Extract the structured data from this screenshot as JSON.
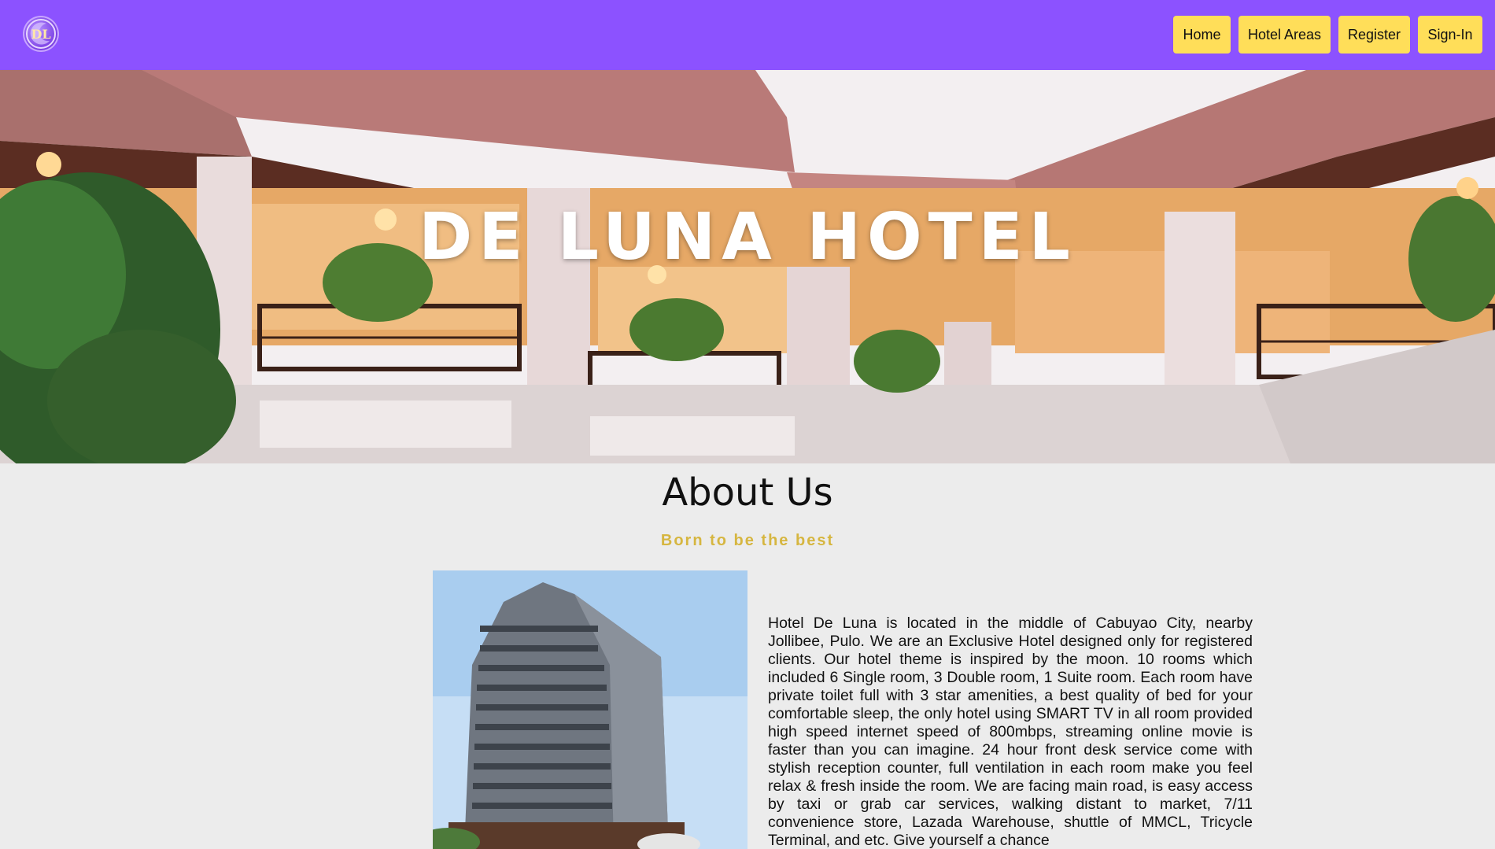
{
  "nav": {
    "logo_text": "DL",
    "items": [
      {
        "label": "Home"
      },
      {
        "label": "Hotel Areas"
      },
      {
        "label": "Register"
      },
      {
        "label": "Sign-In"
      }
    ],
    "colors": {
      "bar": "#8c52ff",
      "button": "#ffde59"
    }
  },
  "hero": {
    "title": "DE LUNA HOTEL"
  },
  "about": {
    "title": "About Us",
    "subtitle": "Born to be the best",
    "body": "Hotel De Luna is located in the middle of Cabuyao City, nearby Jollibee, Pulo. We are an Exclusive Hotel designed only for registered clients. Our hotel theme is inspired by the moon. 10 rooms which included 6 Single room, 3 Double room, 1 Suite room. Each room have private toilet full with 3 star amenities, a best quality of bed for your comfortable sleep, the only hotel using SMART TV in all room provided high speed internet speed of 800mbps, streaming online movie is faster than you can imagine. 24 hour front desk service come with stylish reception counter, full ventilation in each room make you feel relax & fresh inside the room. We are facing main road, is easy access by taxi or grab car services, walking distant to market, 7/11 convenience store, Lazada Warehouse, shuttle of MMCL, Tricycle Terminal, and etc. Give yourself a chance"
  }
}
